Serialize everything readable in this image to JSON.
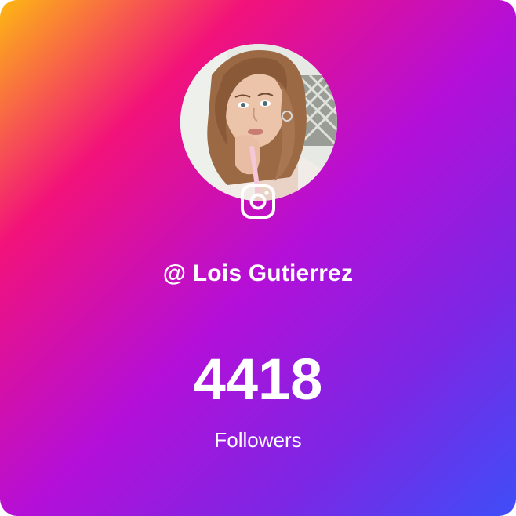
{
  "profile": {
    "handle_prefix": "@",
    "name": "Lois Gutierrez",
    "avatar_icon": "user-photo",
    "platform_icon": "instagram-icon"
  },
  "stats": {
    "followers_count": "4418",
    "followers_label": "Followers"
  },
  "colors": {
    "gradient": [
      "#fdb813",
      "#f2127a",
      "#b40fd8",
      "#7d26e4",
      "#3e4ef8"
    ],
    "text": "#ffffff"
  }
}
